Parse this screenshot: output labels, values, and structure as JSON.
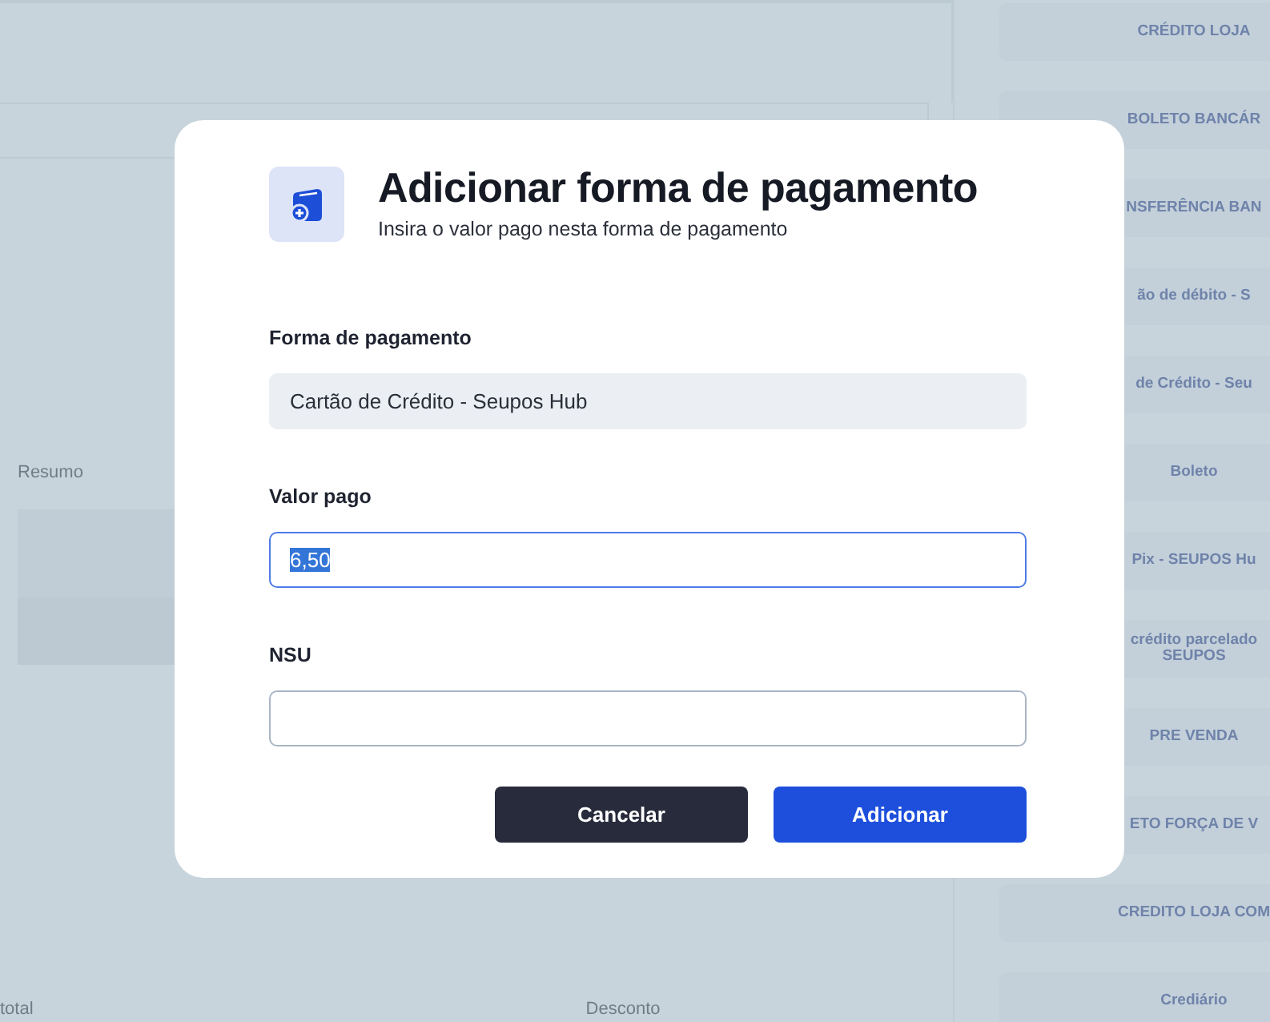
{
  "background": {
    "summary_label": "Resumo",
    "footer_labels": [
      "total",
      "Desconto"
    ],
    "payment_methods": [
      "CRÉDITO LOJA",
      "BOLETO BANCÁR",
      "NSFERÊNCIA BAN",
      "ão de débito - S",
      "de Crédito - Seu",
      "Boleto",
      "Pix - SEUPOS Hu",
      "crédito parcelado\nSEUPOS",
      "PRE VENDA",
      "ETO FORÇA DE V",
      "CREDITO LOJA COM",
      "Crediário"
    ]
  },
  "dialog": {
    "title": "Adicionar forma de pagamento",
    "subtitle": "Insira o valor pago nesta forma de pagamento",
    "fields": [
      {
        "label": "Forma de pagamento",
        "value": "Cartão de Crédito - Seupos Hub",
        "disabled": true,
        "focused": false,
        "text_selected": false
      },
      {
        "label": "Valor pago",
        "value": "6,50",
        "disabled": false,
        "focused": true,
        "text_selected": true
      },
      {
        "label": "NSU",
        "disabled": false,
        "focused": false
      }
    ],
    "buttons": [
      {
        "label": "Cancelar",
        "kind": "secondary"
      },
      {
        "label": "Adicionar",
        "kind": "primary"
      }
    ]
  }
}
